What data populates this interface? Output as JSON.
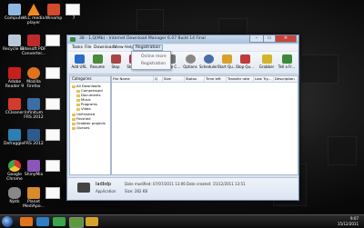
{
  "desktop": {
    "icons": [
      {
        "label": "Computer",
        "color": "#8fb7e0"
      },
      {
        "label": "VLC media\nplayer",
        "color": "#f08a1c"
      },
      {
        "label": "Winamp",
        "color": "#d24b2a"
      },
      {
        "label": "Recycle Bin",
        "color": "#b9c9d8"
      },
      {
        "label": "Bitesoft PDF\nConverter...",
        "color": "#c02a2a"
      },
      {
        "label": "Adobe\nReader 9",
        "color": "#c81e1e"
      },
      {
        "label": "Mozilla\nFirefox",
        "color": "#e0741c"
      },
      {
        "label": "CCleaner",
        "color": "#d33b2e"
      },
      {
        "label": "Infinitum\nFRS 2012",
        "color": "#3c6ea6"
      },
      {
        "label": "Defraggler",
        "color": "#2c7fb3"
      },
      {
        "label": "FRS 2012",
        "color": "#2e5a8c"
      },
      {
        "label": "Google\nChrome",
        "color": "#3aa54a"
      },
      {
        "label": "ShinyMix",
        "color": "#8a56b8"
      },
      {
        "label": "Njstk",
        "color": "#888888"
      },
      {
        "label": "Planet\nMediApo...",
        "color": "#d98a2a"
      }
    ],
    "blank_docs": [
      {
        "label": "7"
      },
      {
        "label": ""
      },
      {
        "label": ""
      },
      {
        "label": ""
      },
      {
        "label": ""
      },
      {
        "label": ""
      },
      {
        "label": ""
      }
    ]
  },
  "window": {
    "title": "38 - 1,Q(Mb) - Internet Download Manager 6.07 Build 14 Final",
    "app_title_short": "Internet Download Manager 6.07",
    "controls": {
      "minimize": "–",
      "maximize": "▭",
      "close": "✕"
    },
    "menus": [
      "Tasks",
      "File",
      "Downloads",
      "View",
      "Help",
      "Registration"
    ],
    "active_menu": "Registration",
    "dropdown": [
      "Online more",
      "Registration"
    ],
    "toolbar": [
      {
        "label": "Add URL",
        "color": "#2b6cc4"
      },
      {
        "label": "Resume",
        "color": "#4a8a3a"
      },
      {
        "label": "Stop",
        "color": "#a44"
      },
      {
        "label": "Stop All",
        "color": "#c24"
      },
      {
        "label": "Delete",
        "color": "#888"
      },
      {
        "label": "Delete C...",
        "color": "#777"
      },
      {
        "label": "Options",
        "color": "#888888"
      },
      {
        "label": "Scheduler",
        "color": "#4a6ea8"
      },
      {
        "label": "Start Qu...",
        "color": "#d7a22a"
      },
      {
        "label": "Stop Qu...",
        "color": "#c03a3a"
      },
      {
        "label": "Grabber",
        "color": "#d5b428"
      },
      {
        "label": "Tell a Fr...",
        "color": "#3a8a3a"
      }
    ],
    "sidebar": {
      "header": "Categories",
      "tree": [
        {
          "label": "All Downloads",
          "level": 0
        },
        {
          "label": "Compressed",
          "level": 1
        },
        {
          "label": "Documents",
          "level": 1
        },
        {
          "label": "Music",
          "level": 1
        },
        {
          "label": "Programs",
          "level": 1
        },
        {
          "label": "Video",
          "level": 1
        },
        {
          "label": "Unfinished",
          "level": 0
        },
        {
          "label": "Finished",
          "level": 0
        },
        {
          "label": "Grabber projects",
          "level": 0
        },
        {
          "label": "Queues",
          "level": 0
        }
      ]
    },
    "columns": [
      "File Name",
      "Q",
      "Size",
      "Status",
      "Time left",
      "Transfer rate",
      "Last Try...",
      "Description"
    ],
    "status_bar": {
      "file_name": "ladbdp",
      "file_type": "Application",
      "date_modified": "Date modified: 07/07/2011 13:06",
      "size": "Size: 282 KB",
      "date_created": "Date created: 15/12/2011 13:51"
    }
  },
  "taskbar": {
    "time": "9:07",
    "date": "15/12/2011",
    "pinned_colors": [
      "#e0741c",
      "#2f7dc5",
      "#3aa54a",
      "#5a9a3a",
      "#d7a22a"
    ]
  }
}
